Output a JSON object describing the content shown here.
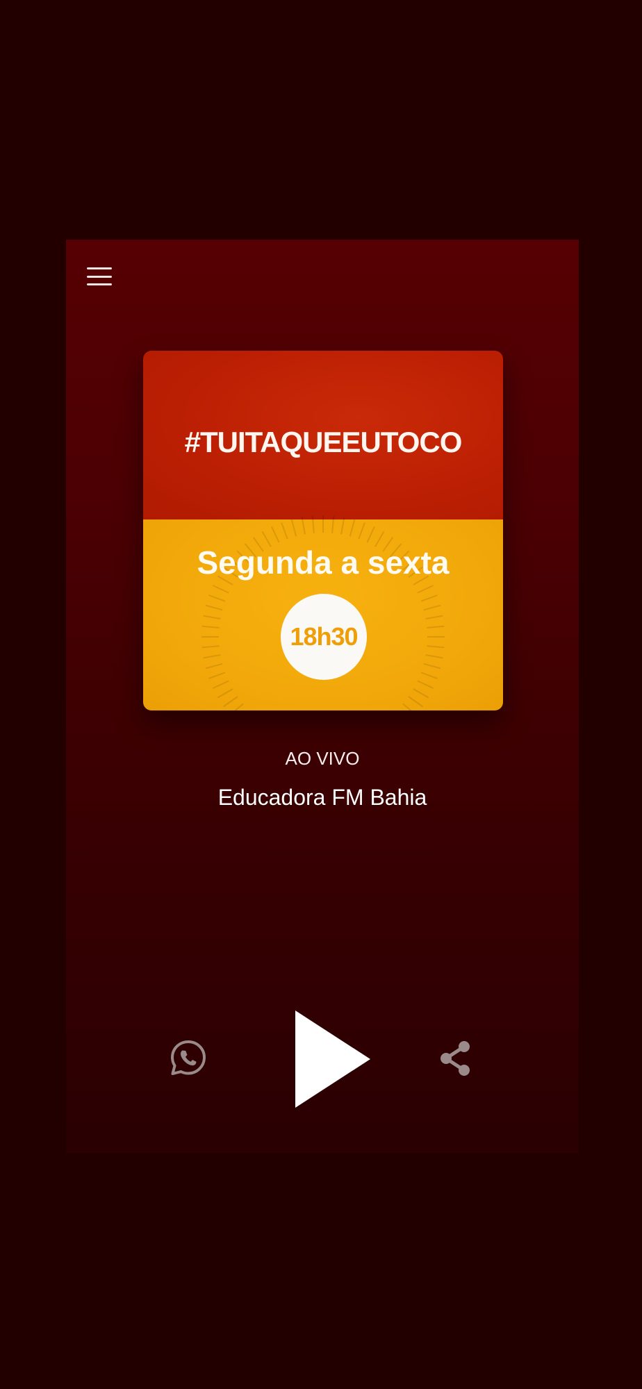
{
  "player": {
    "artwork": {
      "hashtag": "#TUITAQUEEUTOCO",
      "days": "Segunda a sexta",
      "time": "18h30"
    },
    "live_label": "AO VIVO",
    "station_name": "Educadora FM Bahia"
  },
  "icons": {
    "menu": "hamburger-menu-icon",
    "whatsapp": "whatsapp-icon",
    "play": "play-icon",
    "share": "share-icon"
  },
  "colors": {
    "background": "#230000",
    "panel_top": "#560003",
    "artwork_red": "#bc1f03",
    "artwork_yellow": "#f2a80a",
    "icon_gray": "#9a8a8a"
  }
}
